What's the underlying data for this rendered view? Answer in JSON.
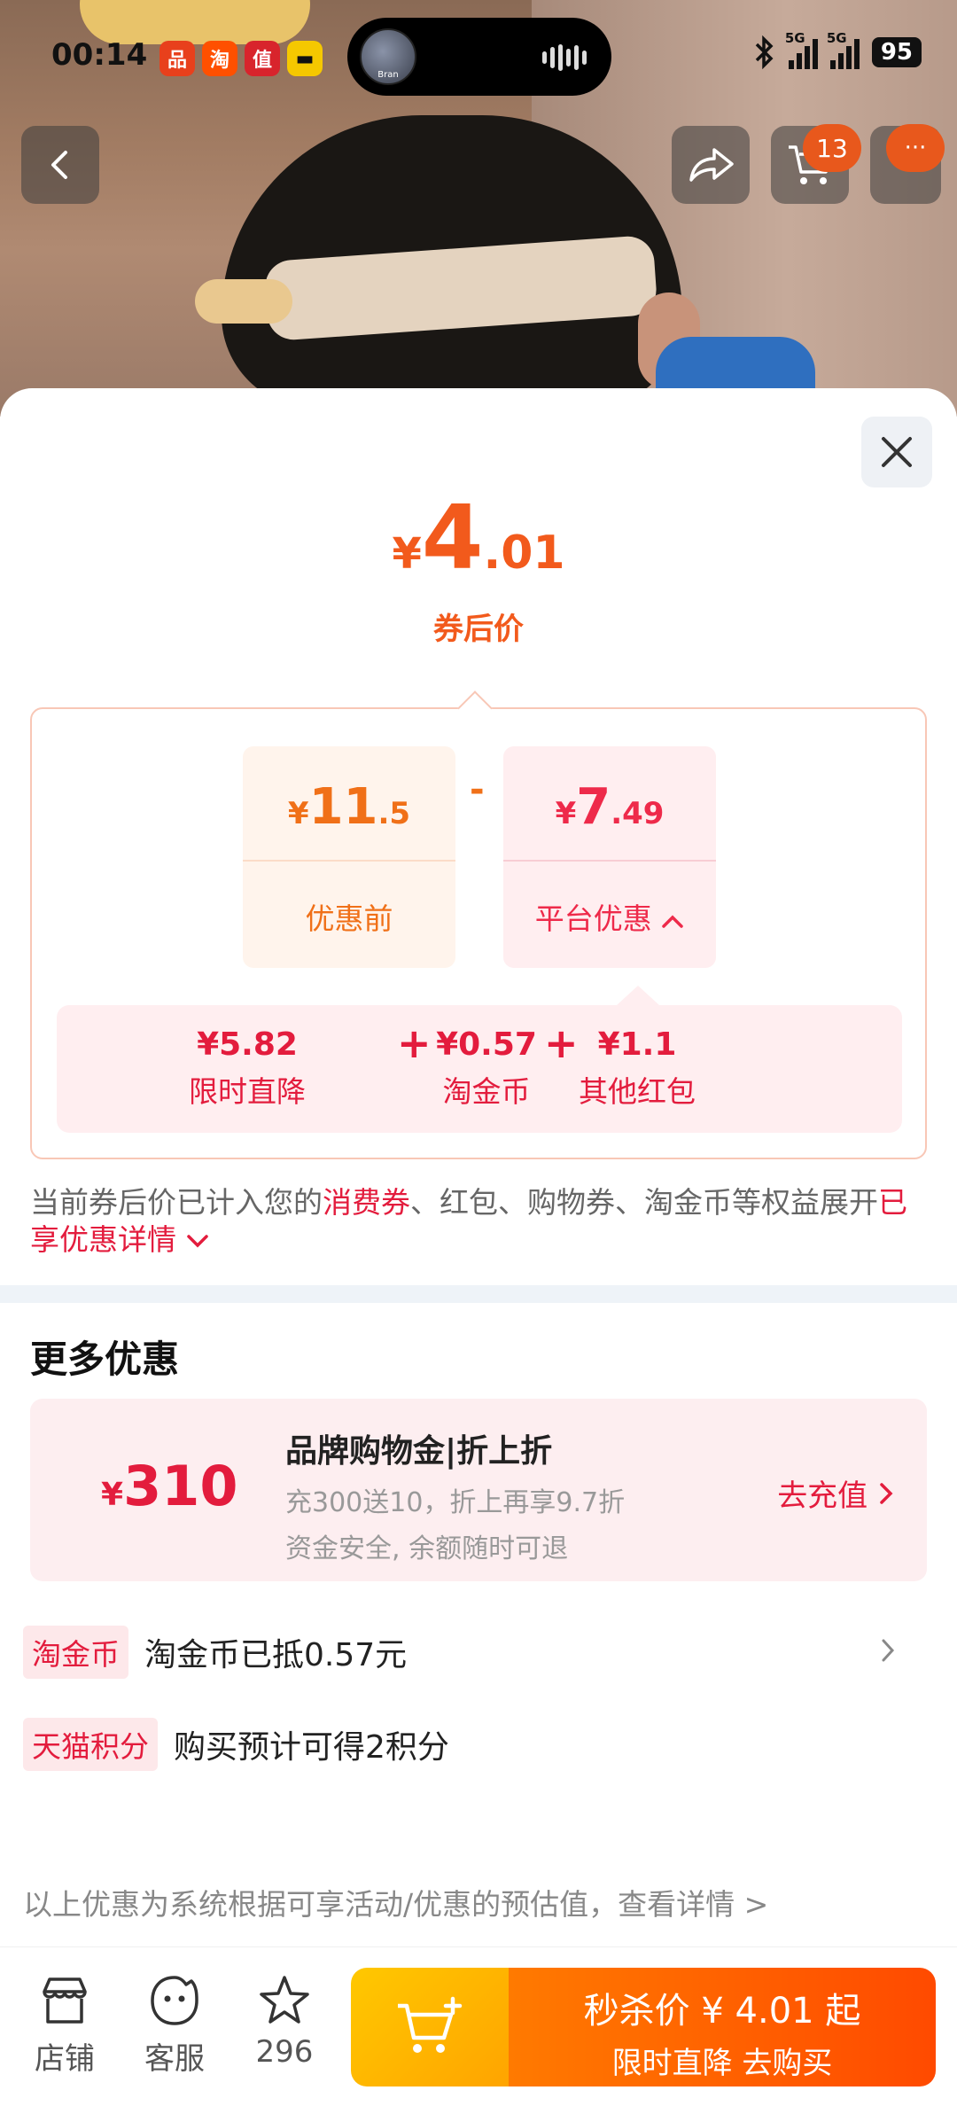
{
  "status": {
    "time": "00:14",
    "apps": [
      {
        "glyph": "品",
        "color": "#e8401c"
      },
      {
        "glyph": "淘",
        "color": "#ff5000"
      },
      {
        "glyph": "值",
        "color": "#d8242c"
      },
      {
        "glyph": "▬",
        "color": "#f5c800"
      }
    ],
    "island_text": "Bran",
    "network": "5G",
    "battery": "95"
  },
  "header": {
    "cart_count": "13",
    "more_badge": "···"
  },
  "price": {
    "symbol": "¥",
    "integer": "4",
    "decimal": ".01",
    "label": "券后价"
  },
  "breakdown": {
    "original": {
      "symbol": "¥",
      "integer": "11",
      "decimal": ".5",
      "label": "优惠前"
    },
    "minus": "-",
    "platform": {
      "symbol": "¥",
      "integer": "7",
      "decimal": ".49",
      "label": "平台优惠"
    },
    "items": [
      {
        "value": "¥5.82",
        "label": "限时直降"
      },
      {
        "value": "¥0.57",
        "label": "淘金币"
      },
      {
        "value": "¥1.1",
        "label": "其他红包"
      }
    ],
    "plus": "+"
  },
  "note": {
    "part1": "当前券后价已计入您的",
    "highlight1": "消费券",
    "part2": "、红包、购物券、淘金币等权益展开",
    "highlight2": "已享优惠详情"
  },
  "more": {
    "title": "更多优惠",
    "card": {
      "symbol": "¥",
      "amount": "310",
      "title": "品牌购物金|折上折",
      "line1": "充300送10，折上再享9.7折",
      "line2": "资金安全, 余额随时可退",
      "action": "去充值"
    },
    "rows": [
      {
        "tag": "淘金币",
        "text": "淘金币已抵0.57元"
      },
      {
        "tag": "天猫积分",
        "text": "购买预计可得2积分"
      }
    ]
  },
  "disclaimer": "以上优惠为系统根据可享活动/优惠的预估值，查看详情 >",
  "bottom": {
    "shop": "店铺",
    "service": "客服",
    "favorites": "296",
    "buy_line1": "秒杀价 ¥ 4.01 起",
    "buy_line2": "限时直降  去购买"
  }
}
